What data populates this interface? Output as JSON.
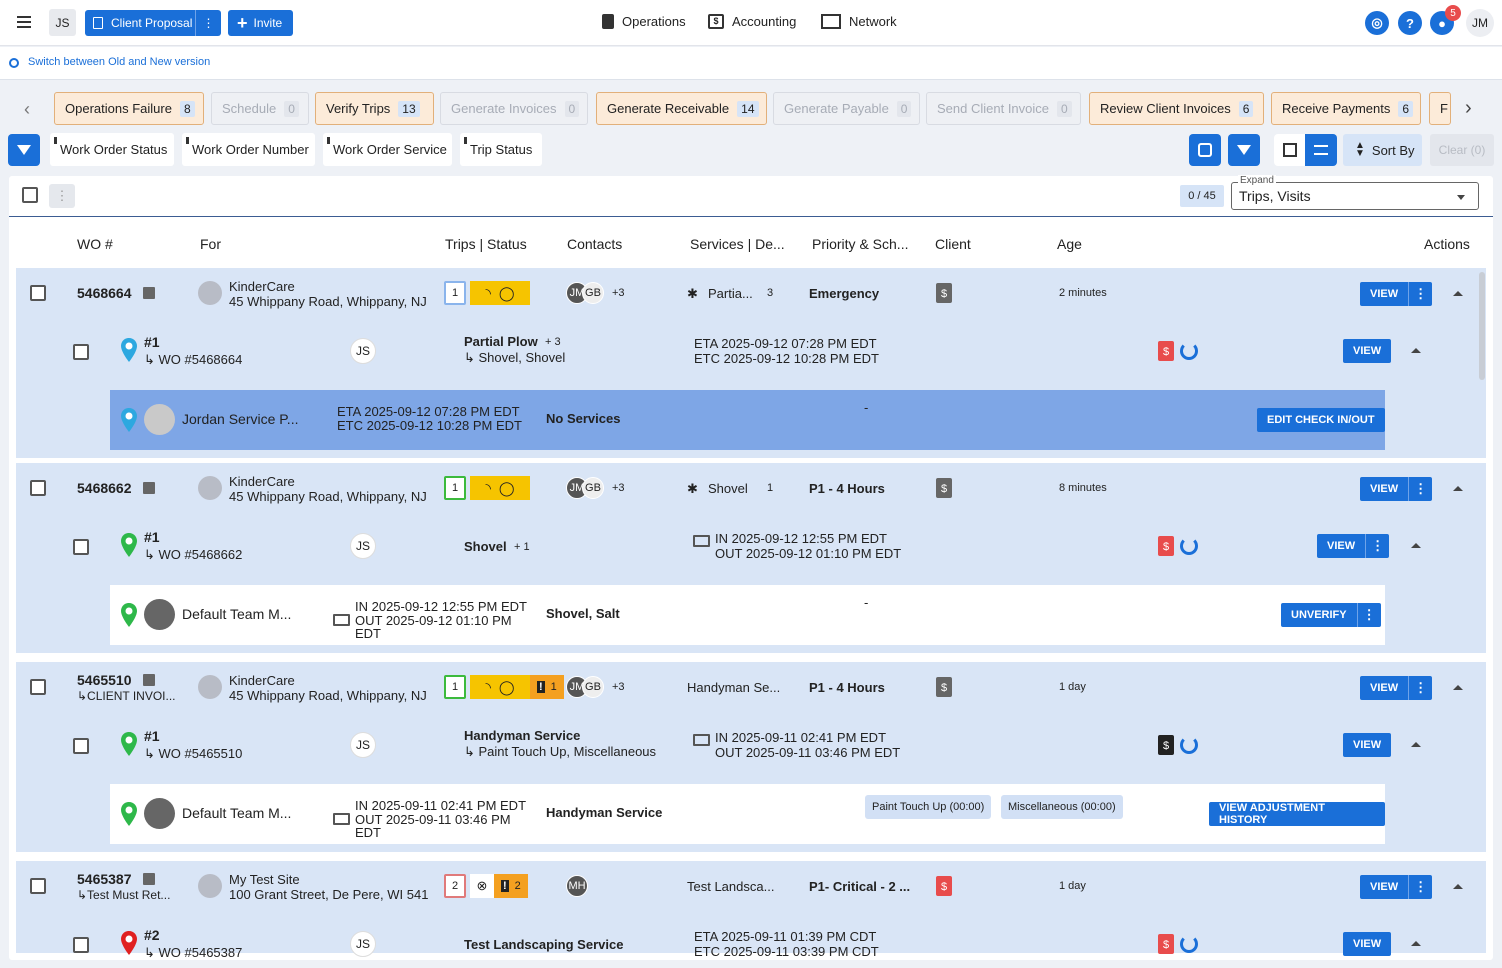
{
  "topbar": {
    "user_initials": "JS",
    "proposal_label": "Client Proposal",
    "invite_label": "Invite",
    "nav": [
      "Operations",
      "Accounting",
      "Network"
    ],
    "notification_count": "5",
    "profile_initials": "JM"
  },
  "switch_link": "Switch between Old and New version",
  "pipeline": [
    {
      "label": "Operations Failure",
      "count": "8",
      "active": true
    },
    {
      "label": "Schedule",
      "count": "0",
      "active": false
    },
    {
      "label": "Verify Trips",
      "count": "13",
      "active": true
    },
    {
      "label": "Generate Invoices",
      "count": "0",
      "active": false
    },
    {
      "label": "Generate Receivable",
      "count": "14",
      "active": true
    },
    {
      "label": "Generate Payable",
      "count": "0",
      "active": false
    },
    {
      "label": "Send Client Invoice",
      "count": "0",
      "active": false
    },
    {
      "label": "Review Client Invoices",
      "count": "6",
      "active": true
    },
    {
      "label": "Receive Payments",
      "count": "6",
      "active": true
    },
    {
      "label": "F",
      "count": "",
      "active": true
    }
  ],
  "filters": [
    "Work Order Status",
    "Work Order Number",
    "Work Order Service",
    "Trip Status"
  ],
  "toolbar": {
    "sort_label": "Sort By",
    "clear_label": "Clear (0)",
    "selection": "0 / 45",
    "expand_label": "Expand",
    "expand_value": "Trips, Visits"
  },
  "columns": [
    "WO #",
    "For",
    "Trips | Status",
    "Contacts",
    "Services | De...",
    "Priority & Sch...",
    "Client",
    "Age",
    "Actions"
  ],
  "work_orders": [
    {
      "wo": "5468664",
      "sub": "",
      "client": "KinderCare",
      "address": "45 Whippany Road, Whippany, NJ",
      "trips": "1",
      "contacts": [
        "JM",
        "GB"
      ],
      "contacts_more": "+3",
      "service": "Partia...",
      "service_count": "3",
      "priority": "Emergency",
      "age": "2 minutes",
      "view": "VIEW",
      "trip": {
        "num": "#1",
        "wo_ref": "↳ WO #5468664",
        "tech": "JS",
        "service": "Partial Plow",
        "service_more": "+ 3",
        "sub_service": "↳ Shovel, Shovel",
        "line1": "ETA 2025-09-12 07:28 PM EDT",
        "line2": "ETC 2025-09-12 10:28 PM EDT",
        "view": "VIEW"
      },
      "visit": {
        "name": "Jordan Service P...",
        "line1": "ETA 2025-09-12 07:28 PM EDT",
        "line2": "ETC 2025-09-12 10:28 PM EDT",
        "line3": "",
        "services": "No Services",
        "dash": "-",
        "action": "EDIT CHECK IN/OUT"
      }
    },
    {
      "wo": "5468662",
      "sub": "",
      "client": "KinderCare",
      "address": "45 Whippany Road, Whippany, NJ",
      "trips": "1",
      "contacts": [
        "JM",
        "GB"
      ],
      "contacts_more": "+3",
      "service": "Shovel",
      "service_count": "1",
      "priority": "P1 - 4 Hours",
      "age": "8 minutes",
      "view": "VIEW",
      "trip": {
        "num": "#1",
        "wo_ref": "↳ WO #5468662",
        "tech": "JS",
        "service": "Shovel",
        "service_more": "+ 1",
        "sub_service": "",
        "line1": "IN 2025-09-12 12:55 PM EDT",
        "line2": "OUT 2025-09-12 01:10 PM EDT",
        "view": "VIEW"
      },
      "visit": {
        "name": "Default Team M...",
        "line1": "IN 2025-09-12 12:55 PM EDT",
        "line2": "OUT 2025-09-12 01:10 PM",
        "line3": "EDT",
        "services": "Shovel, Salt",
        "dash": "-",
        "action": "UNVERIFY"
      }
    },
    {
      "wo": "5465510",
      "sub": "↳CLIENT INVOI...",
      "client": "KinderCare",
      "address": "45 Whippany Road, Whippany, NJ",
      "trips": "1",
      "alert_count": "1",
      "contacts": [
        "JM",
        "GB"
      ],
      "contacts_more": "+3",
      "service": "Handyman Se...",
      "service_count": "",
      "priority": "P1 - 4 Hours",
      "age": "1 day",
      "view": "VIEW",
      "trip": {
        "num": "#1",
        "wo_ref": "↳ WO #5465510",
        "tech": "JS",
        "service": "Handyman Service",
        "service_more": "",
        "sub_service": "↳ Paint Touch Up, Miscellaneous",
        "line1": "IN 2025-09-11 02:41 PM EDT",
        "line2": "OUT 2025-09-11 03:46 PM EDT",
        "view": "VIEW"
      },
      "visit": {
        "name": "Default Team M...",
        "line1": "IN 2025-09-11 02:41 PM EDT",
        "line2": "OUT 2025-09-11 03:46 PM",
        "line3": "EDT",
        "services": "Handyman Service",
        "tags": [
          "Paint Touch Up (00:00)",
          "Miscellaneous (00:00)"
        ],
        "action": "VIEW ADJUSTMENT HISTORY"
      }
    },
    {
      "wo": "5465387",
      "sub": "↳Test Must Ret...",
      "client": "My Test Site",
      "address": "100 Grant Street, De Pere, WI 541",
      "trips": "2",
      "alert_count": "2",
      "contacts": [
        "MH"
      ],
      "contacts_more": "",
      "service": "Test Landsca...",
      "service_count": "",
      "priority": "P1- Critical - 2 ...",
      "age": "1 day",
      "view": "VIEW",
      "trip": {
        "num": "#2",
        "wo_ref": "↳ WO #5465387",
        "tech": "JS",
        "service": "Test Landscaping Service",
        "service_more": "",
        "sub_service": "",
        "line1": "ETA 2025-09-11 01:39 PM CDT",
        "line2": "ETC 2025-09-11 03:39 PM CDT",
        "view": "VIEW"
      }
    }
  ],
  "colors": {
    "primary": "#1a6fd8",
    "row_bg": "#d9e5f6",
    "visit_bg": "#7ea6e6",
    "yellow": "#f6c400",
    "orange": "#f4a020"
  }
}
